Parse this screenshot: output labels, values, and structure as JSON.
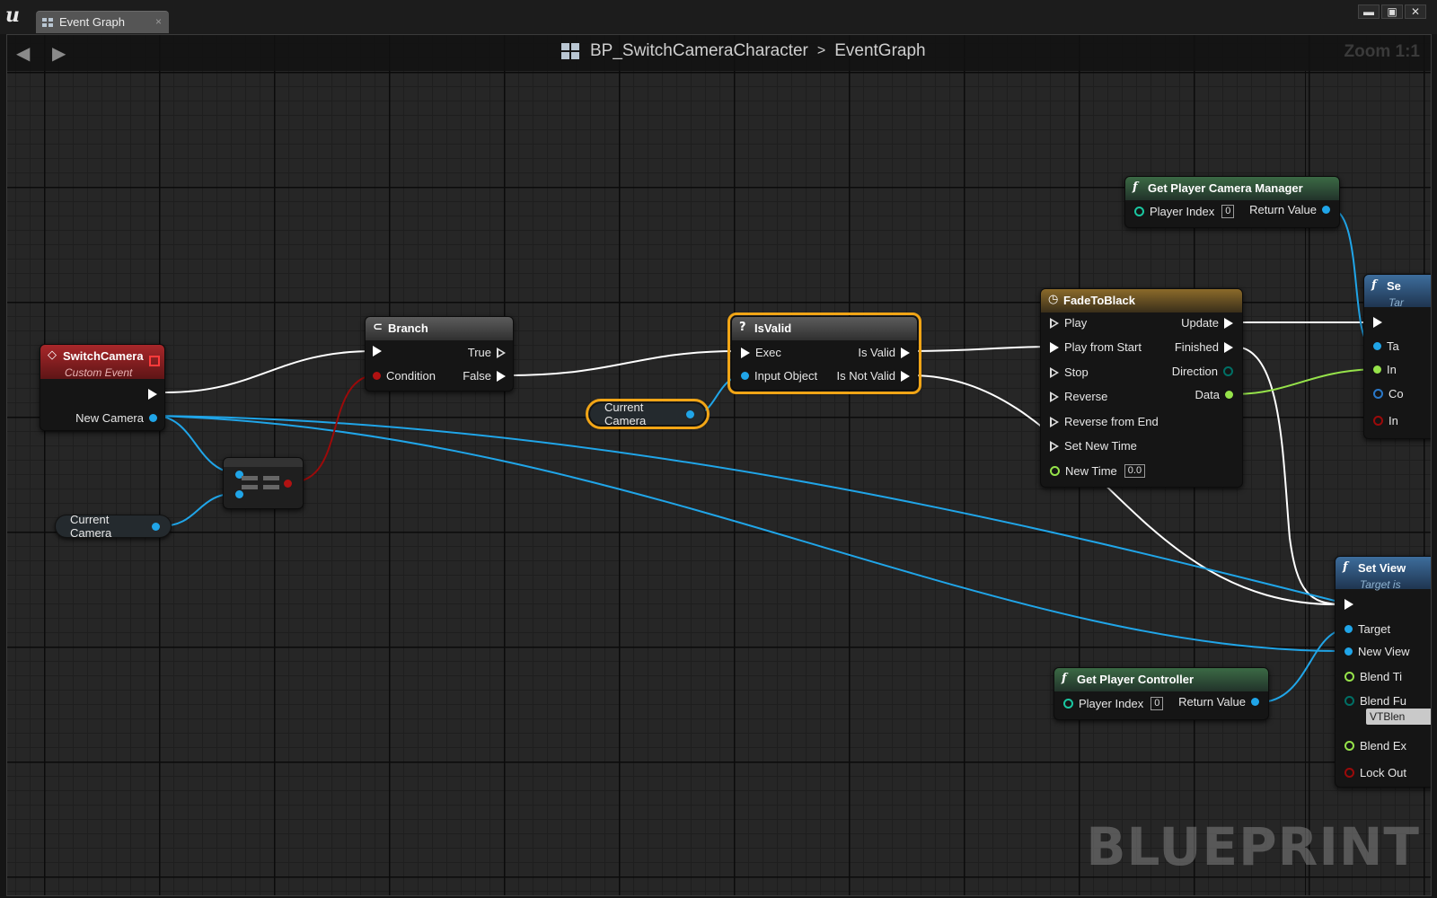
{
  "tab": {
    "label": "Event Graph",
    "close": "×"
  },
  "window": {
    "minimize": "▬",
    "maximize": "▣",
    "close": "✕"
  },
  "breadcrumb": {
    "blueprint": "BP_SwitchCameraCharacter",
    "separator": ">",
    "graph": "EventGraph"
  },
  "zoom": "Zoom 1:1",
  "watermark": "BLUEPRINT",
  "colors": {
    "exec": "#ffffff",
    "object": "#20a5e8",
    "bool": "#9b0a0a",
    "float": "#96e34a",
    "struct": "#2a78c8",
    "byte": "#006f65",
    "selection": "#f1a516"
  },
  "nodes": {
    "switch_camera": {
      "title": "SwitchCamera",
      "subtitle": "Custom Event",
      "pin_new_camera": "New Camera"
    },
    "branch": {
      "title": "Branch",
      "pin_condition": "Condition",
      "pin_true": "True",
      "pin_false": "False"
    },
    "isvalid": {
      "title": "IsValid",
      "pin_exec": "Exec",
      "pin_input": "Input Object",
      "pin_is_valid": "Is Valid",
      "pin_is_not_valid": "Is Not Valid"
    },
    "current_camera_1": {
      "label": "Current Camera"
    },
    "current_camera_2": {
      "label": "Current Camera"
    },
    "fade": {
      "title": "FadeToBlack",
      "pin_play": "Play",
      "pin_play_start": "Play from Start",
      "pin_stop": "Stop",
      "pin_reverse": "Reverse",
      "pin_reverse_end": "Reverse from End",
      "pin_set_time": "Set New Time",
      "pin_new_time": "New Time",
      "new_time_value": "0.0",
      "pin_update": "Update",
      "pin_finished": "Finished",
      "pin_direction": "Direction",
      "pin_data": "Data"
    },
    "camera_manager": {
      "title": "Get Player Camera Manager",
      "pin_player_index": "Player Index",
      "player_index_value": "0",
      "pin_return": "Return Value"
    },
    "set_partial": {
      "title": "Se",
      "subtitle": "Tar",
      "pin_ta": "Ta",
      "pin_in1": "In",
      "pin_co": "Co",
      "pin_in2": "In"
    },
    "set_view": {
      "title": "Set View",
      "subtitle": "Target is",
      "pin_target": "Target",
      "pin_new_view": "New View",
      "pin_blend_time": "Blend Ti",
      "pin_blend_func": "Blend Fu",
      "blend_func_value": "VTBlen",
      "pin_blend_exp": "Blend Ex",
      "pin_lock": "Lock Out"
    },
    "player_controller": {
      "title": "Get Player Controller",
      "pin_player_index": "Player Index",
      "player_index_value": "0",
      "pin_return": "Return Value"
    }
  }
}
